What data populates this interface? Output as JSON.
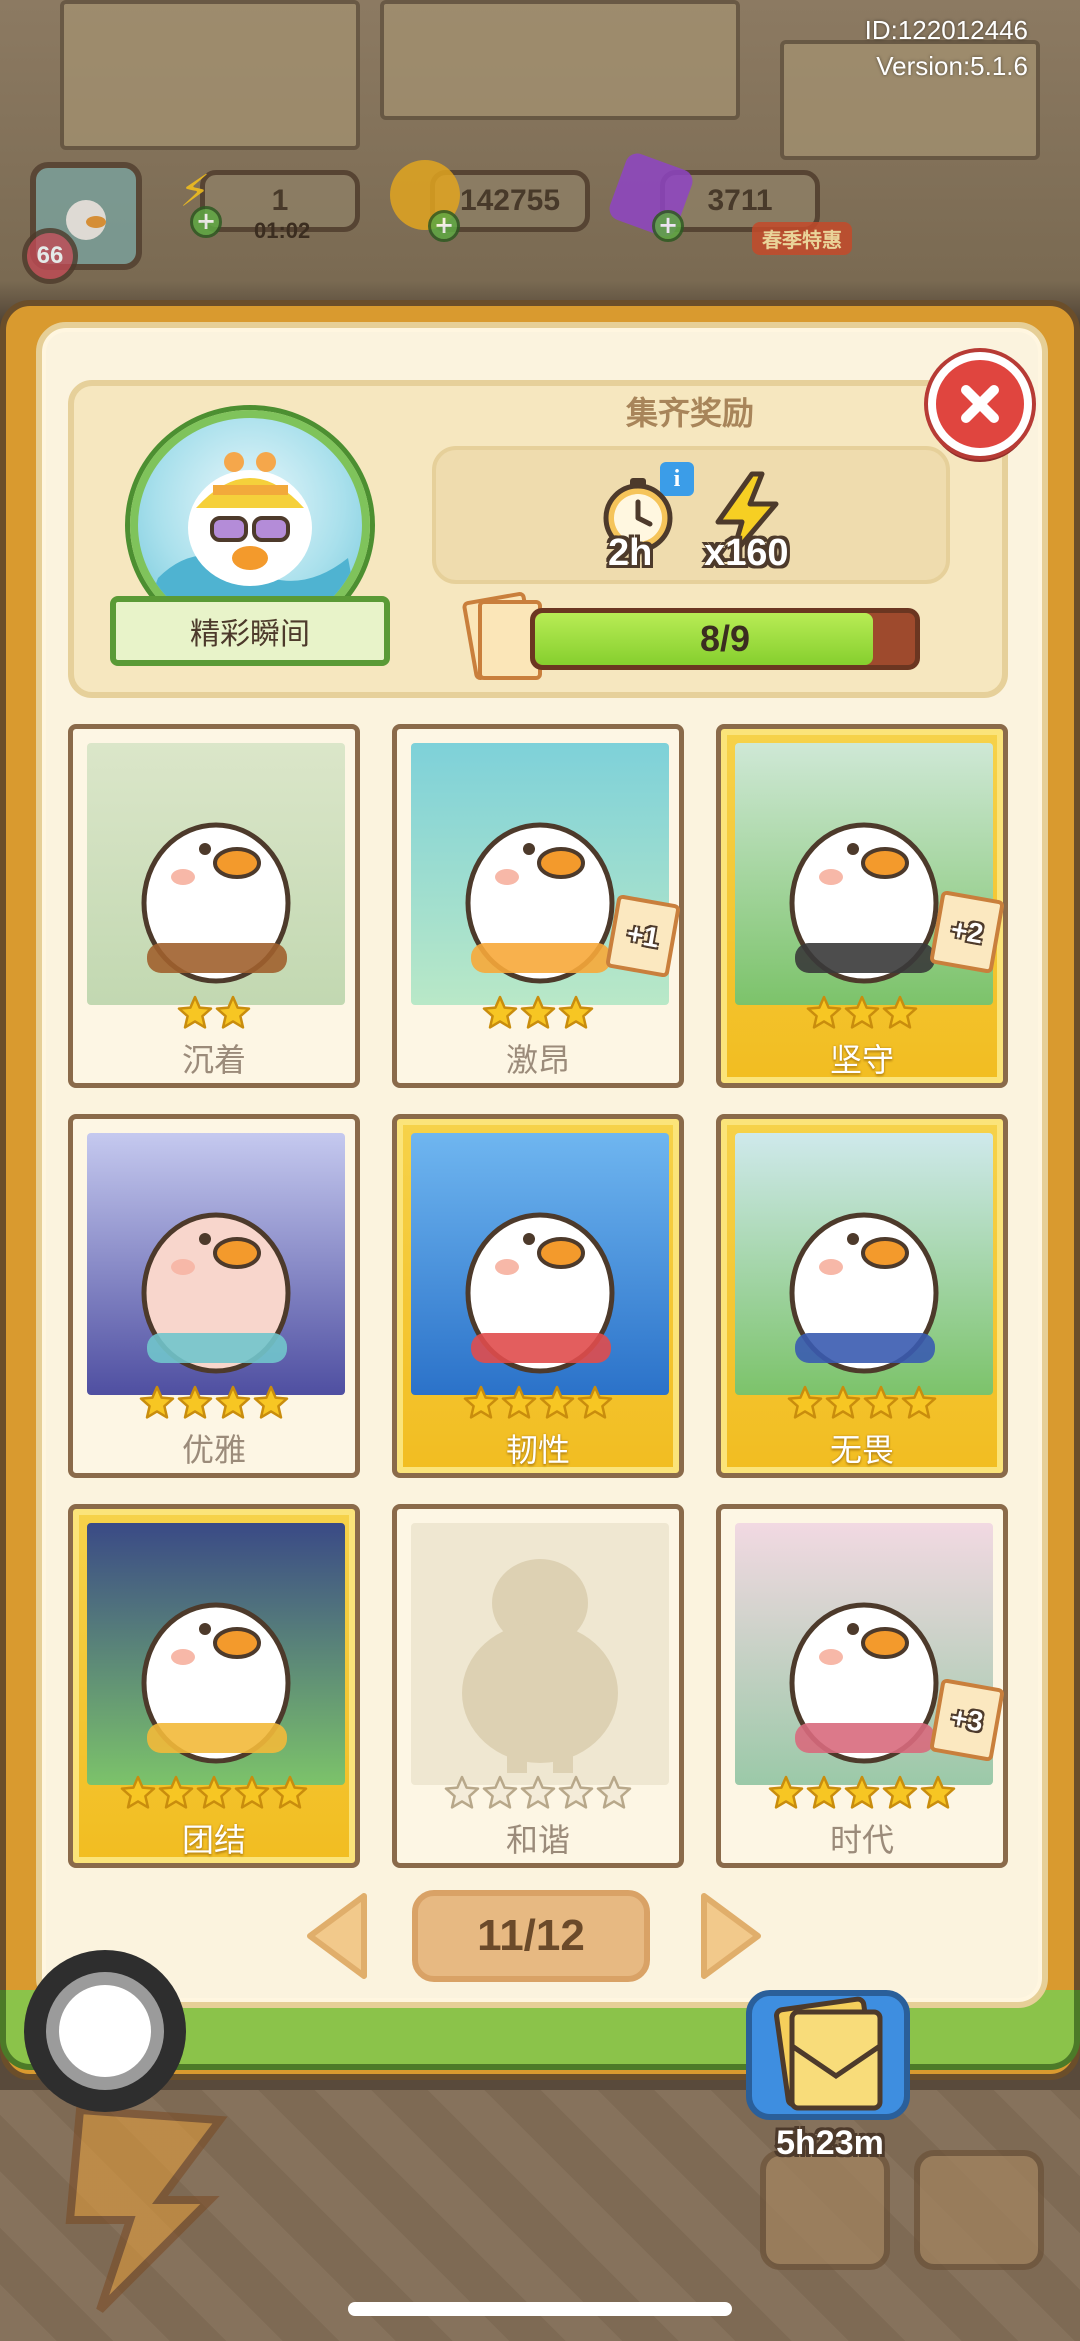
{
  "header": {
    "id_text": "ID:122012446",
    "version_text": "Version:5.1.6"
  },
  "hud": {
    "level": "66",
    "energy": "1",
    "energy_timer": "01:02",
    "coins": "142755",
    "gems": "3711",
    "promo_label": "春季特惠"
  },
  "collection": {
    "badge_label": "精彩瞬间",
    "reward_title": "集齐奖励",
    "reward_time": "2h",
    "reward_energy": "x160",
    "progress_text": "8/9",
    "progress_fraction": 0.889
  },
  "cards": [
    {
      "name": "沉着",
      "stars": 2,
      "gold": false,
      "collected": true,
      "dup": ""
    },
    {
      "name": "激昂",
      "stars": 3,
      "gold": false,
      "collected": true,
      "dup": "+1"
    },
    {
      "name": "坚守",
      "stars": 3,
      "gold": true,
      "collected": true,
      "dup": "+2"
    },
    {
      "name": "优雅",
      "stars": 4,
      "gold": false,
      "collected": true,
      "dup": ""
    },
    {
      "name": "韧性",
      "stars": 4,
      "gold": true,
      "collected": true,
      "dup": ""
    },
    {
      "name": "无畏",
      "stars": 4,
      "gold": true,
      "collected": true,
      "dup": ""
    },
    {
      "name": "团结",
      "stars": 5,
      "gold": true,
      "collected": true,
      "dup": ""
    },
    {
      "name": "和谐",
      "stars": 5,
      "gold": false,
      "collected": false,
      "dup": ""
    },
    {
      "name": "时代",
      "stars": 5,
      "gold": false,
      "collected": true,
      "dup": "+3"
    }
  ],
  "pagination": {
    "page_text": "11/12"
  },
  "pack": {
    "timer": "5h23m"
  },
  "colors": {
    "star_filled": "#f7c623",
    "star_empty": "#f4ecd9",
    "gold_card": "#f2bd21",
    "progress_fill": "#9ee03a",
    "close_button": "#e0453f"
  }
}
